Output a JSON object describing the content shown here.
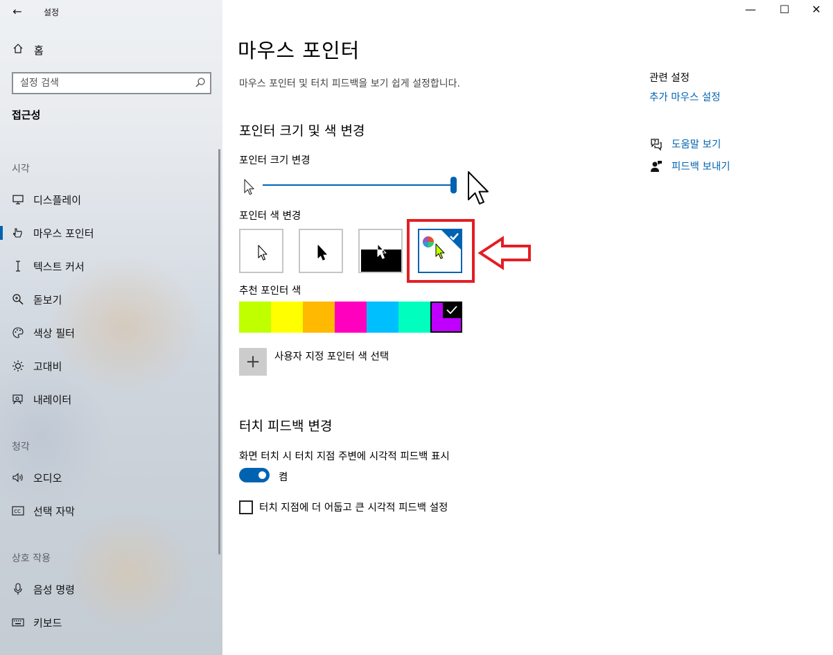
{
  "window": {
    "title": "설정",
    "back_glyph": "←",
    "controls": {
      "minimize": "—",
      "maximize": "☐",
      "close": "✕"
    }
  },
  "sidebar": {
    "home_label": "홈",
    "search_placeholder": "설정 검색",
    "current_section": "접근성",
    "groups": {
      "vision": "시각",
      "hearing": "청각",
      "interaction": "상호 작용"
    },
    "items": [
      {
        "label": "디스플레이",
        "icon": "monitor-icon"
      },
      {
        "label": "마우스 포인터",
        "icon": "pointer-icon",
        "active": true
      },
      {
        "label": "텍스트 커서",
        "icon": "text-cursor-icon"
      },
      {
        "label": "돋보기",
        "icon": "magnifier-icon"
      },
      {
        "label": "색상 필터",
        "icon": "palette-icon"
      },
      {
        "label": "고대비",
        "icon": "contrast-sun-icon"
      },
      {
        "label": "내레이터",
        "icon": "narrator-icon"
      },
      {
        "label": "오디오",
        "icon": "speaker-icon"
      },
      {
        "label": "선택 자막",
        "icon": "captions-icon"
      },
      {
        "label": "음성 명령",
        "icon": "microphone-icon"
      },
      {
        "label": "키보드",
        "icon": "keyboard-icon"
      }
    ]
  },
  "main": {
    "title": "마우스 포인터",
    "subtitle": "마우스 포인터 및 터치 피드백을 보기 쉽게 설정합니다.",
    "pointer_section_title": "포인터 크기 및 색 변경",
    "size_label": "포인터 크기 변경",
    "size_value": 1.0,
    "color_label": "포인터 색 변경",
    "pointer_styles": [
      {
        "name": "white",
        "selected": false
      },
      {
        "name": "black",
        "selected": false
      },
      {
        "name": "inverted",
        "selected": false
      },
      {
        "name": "custom",
        "selected": true
      }
    ],
    "recommended_label": "추천 포인터 색",
    "recommended_colors": [
      "#bfff00",
      "#ffff00",
      "#ffb900",
      "#ff00bf",
      "#00bfff",
      "#00ffbf",
      "#bf00ff"
    ],
    "selected_color_index": 6,
    "custom_color_label": "사용자 지정 포인터 색 선택",
    "custom_color_glyph": "+",
    "touch_section_title": "터치 피드백 변경",
    "touch_feedback_label": "화면 터치 시 터치 지점 주변에 시각적 피드백 표시",
    "touch_toggle_state": "켬",
    "touch_toggle_on": true,
    "darker_feedback_label": "터치 지점에 더 어둡고 큰 시각적 피드백 설정",
    "darker_feedback_checked": false
  },
  "related": {
    "title": "관련 설정",
    "additional_mouse_link": "추가 마우스 설정",
    "help_link": "도움말 보기",
    "feedback_link": "피드백 보내기"
  },
  "colors": {
    "accent": "#0063b1",
    "highlight_red": "#e31e24"
  }
}
